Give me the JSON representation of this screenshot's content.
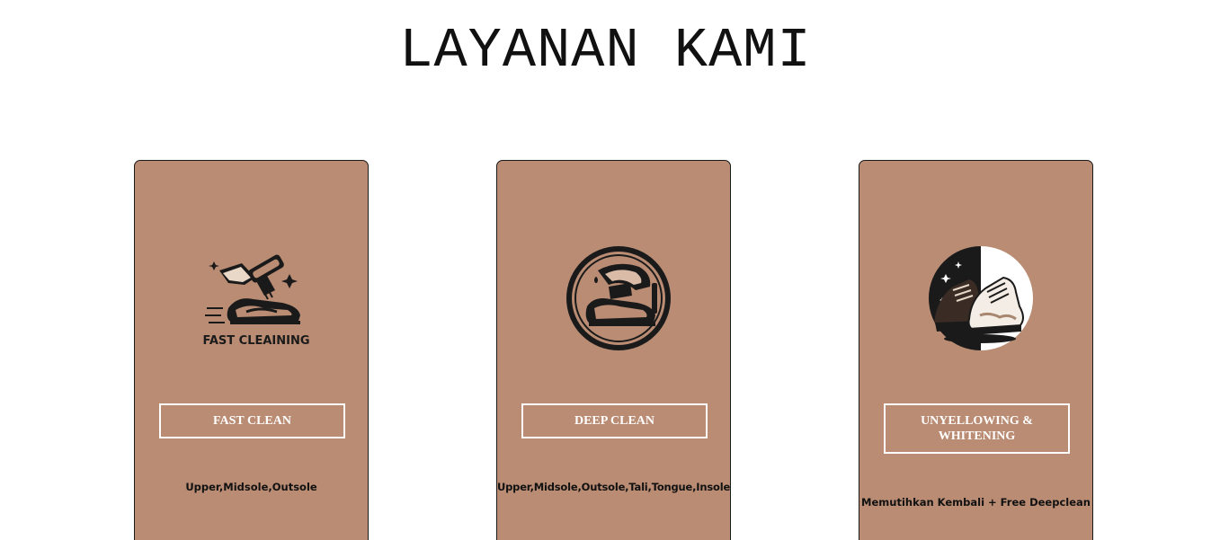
{
  "page": {
    "title": "LAYANAN KAMI"
  },
  "colors": {
    "card_background": "#b98c73",
    "button_border": "#ffffff",
    "text_dark": "#111111"
  },
  "services": [
    {
      "icon": "fast-cleaning-icon",
      "icon_text": "FAST CLEAINING",
      "button_label": "FAST CLEAN",
      "description": "Upper,Midsole,Outsole"
    },
    {
      "icon": "deep-clean-icon",
      "button_label": "DEEP CLEAN",
      "description": "Upper,Midsole,Outsole,Tali,Tongue,Insole"
    },
    {
      "icon": "unyellowing-icon",
      "button_label": "UNYELLOWING & WHITENING",
      "description": "Memutihkan Kembali + Free Deepclean"
    }
  ]
}
